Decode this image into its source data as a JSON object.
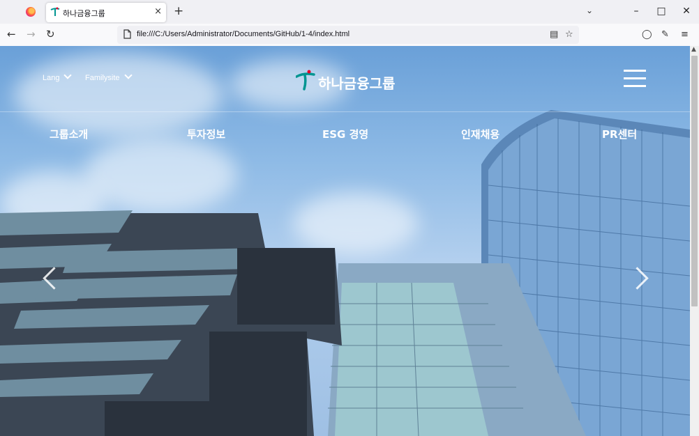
{
  "browser": {
    "tab_title": "하나금융그룹",
    "tab_close": "×",
    "new_tab": "+",
    "url": "file:///C:/Users/Administrator/Documents/GitHub/1-4/index.html"
  },
  "site": {
    "lang_label": "Lang",
    "familysite_label": "Familysite",
    "logo_text": "하나금융그룹",
    "nav": [
      "그룹소개",
      "투자정보",
      "ESG 경영",
      "인재채용",
      "PR센터"
    ],
    "colors": {
      "brand_green": "#009591",
      "brand_red": "#e4002b",
      "sky": "#8fbbe6"
    }
  }
}
